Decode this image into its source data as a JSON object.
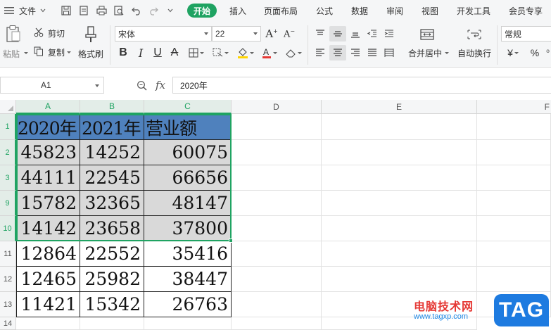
{
  "menubar": {
    "file_menu": "文件",
    "tabs": [
      "开始",
      "插入",
      "页面布局",
      "公式",
      "数据",
      "审阅",
      "视图",
      "开发工具",
      "会员专享"
    ]
  },
  "ribbon": {
    "paste": "粘贴",
    "cut": "剪切",
    "copy": "复制",
    "format_painter": "格式刷",
    "font_name": "宋体",
    "font_size": "22",
    "merge_center": "合并居中",
    "wrap_text": "自动换行",
    "number_format": "常规",
    "currency_symbol": "¥",
    "percent_symbol": "%"
  },
  "formula_bar": {
    "name_box": "A1",
    "fx_label": "fx",
    "formula": "2020年"
  },
  "sheet": {
    "columns": [
      "A",
      "B",
      "C",
      "D",
      "E",
      "F"
    ],
    "row_numbers": [
      "1",
      "2",
      "3",
      "9",
      "10",
      "11",
      "12",
      "13",
      "14"
    ],
    "headers": [
      "2020年",
      "2021年",
      "营业额"
    ],
    "rows": [
      [
        "45823",
        "14252",
        "60075"
      ],
      [
        "44111",
        "22545",
        "66656"
      ],
      [
        "15782",
        "32365",
        "48147"
      ],
      [
        "14142",
        "23658",
        "37800"
      ],
      [
        "12864",
        "22552",
        "35416"
      ],
      [
        "12465",
        "25982",
        "38447"
      ],
      [
        "11421",
        "15342",
        "26763"
      ]
    ]
  },
  "colors": {
    "accent_green": "#1fa362",
    "header_fill": "#4f81bd",
    "selection_fill": "#d9d9d9"
  },
  "watermark": {
    "site_name": "电脑技术网",
    "url": "www.tagxp.com",
    "badge": "TAG"
  }
}
